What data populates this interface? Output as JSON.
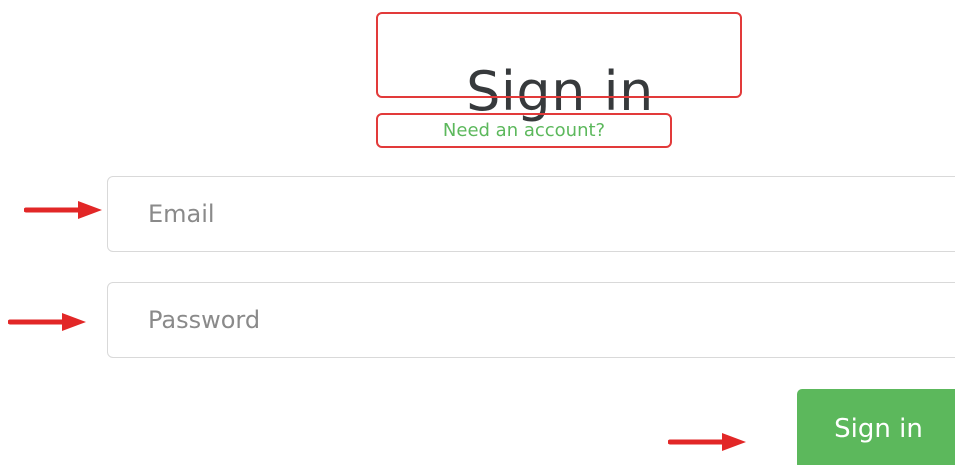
{
  "form": {
    "title": "Sign in",
    "need_account_link": "Need an account?",
    "email": {
      "value": "",
      "placeholder": "Email"
    },
    "password": {
      "value": "",
      "placeholder": "Password"
    },
    "submit_label": "Sign in"
  },
  "annotations": {
    "highlight_color": "#e23a3a",
    "arrow_color": "#e22727",
    "arrow_icon": "right-arrow-icon"
  },
  "colors": {
    "brand_green": "#5cb85c",
    "title_text": "#373a3c"
  }
}
